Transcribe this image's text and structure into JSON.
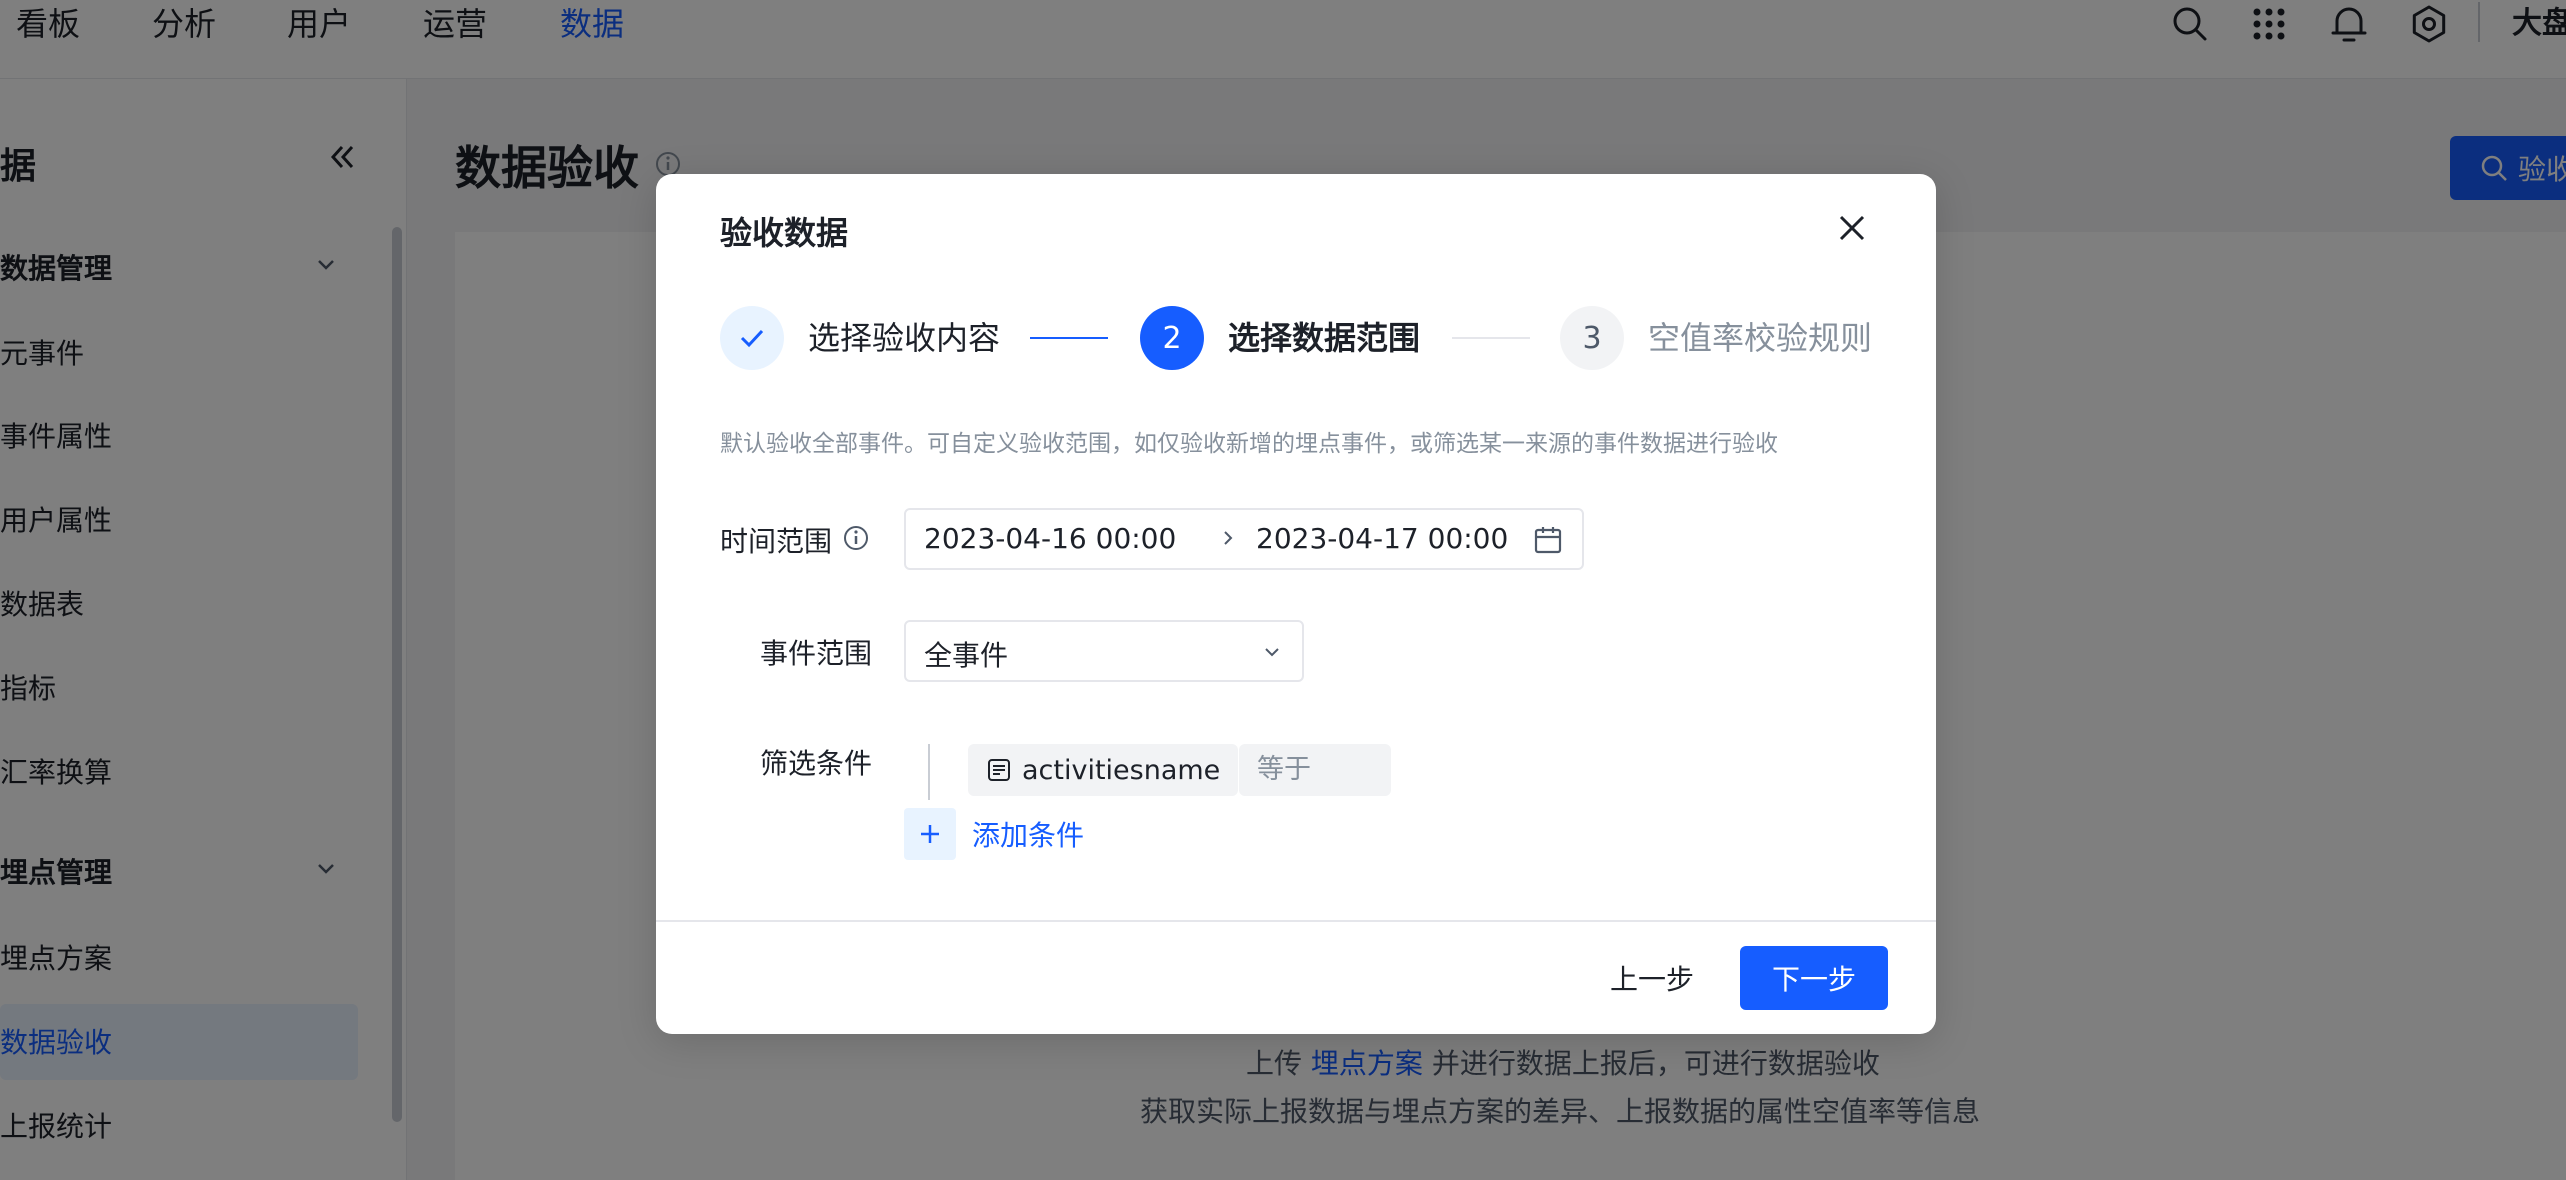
{
  "topnav": {
    "items": [
      {
        "label": "看板"
      },
      {
        "label": "分析"
      },
      {
        "label": "用户"
      },
      {
        "label": "运营"
      },
      {
        "label": "数据",
        "active": true
      }
    ],
    "icons": [
      "search-icon",
      "apps-grid-icon",
      "bell-icon",
      "gear-icon"
    ],
    "user": "大盘"
  },
  "sidebar": {
    "title": "据",
    "groups": [
      {
        "label": "数据管理",
        "items": [
          "元事件",
          "事件属性",
          "用户属性",
          "数据表",
          "指标",
          "汇率换算"
        ]
      },
      {
        "label": "埋点管理",
        "items": [
          "埋点方案",
          "数据验收",
          "上报统计"
        ]
      }
    ],
    "active_item": "数据验收"
  },
  "page": {
    "title": "数据验收",
    "top_button": "验收",
    "empty_line1_prefix": "上传",
    "empty_line1_link": "埋点方案",
    "empty_line1_suffix": "并进行数据上报后，可进行数据验收",
    "empty_line2": "获取实际上报数据与埋点方案的差异、上报数据的属性空值率等信息"
  },
  "modal": {
    "title": "验收数据",
    "steps": [
      {
        "label": "选择验收内容",
        "state": "done"
      },
      {
        "number": "2",
        "label": "选择数据范围",
        "state": "active"
      },
      {
        "number": "3",
        "label": "空值率校验规则",
        "state": "wait"
      }
    ],
    "hint": "默认验收全部事件。可自定义验收范围，如仅验收新增的埋点事件，或筛选某一来源的事件数据进行验收",
    "time_range": {
      "label": "时间范围",
      "start": "2023-04-16 00:00",
      "end": "2023-04-17 00:00"
    },
    "event_range": {
      "label": "事件范围",
      "value": "全事件"
    },
    "filter": {
      "label": "筛选条件",
      "field": "activitiesname",
      "operator": "等于",
      "add_label": "添加条件"
    },
    "footer": {
      "prev": "上一步",
      "next": "下一步"
    }
  },
  "colors": {
    "primary": "#165dff",
    "mask": "rgba(0,0,0,0.5)"
  }
}
